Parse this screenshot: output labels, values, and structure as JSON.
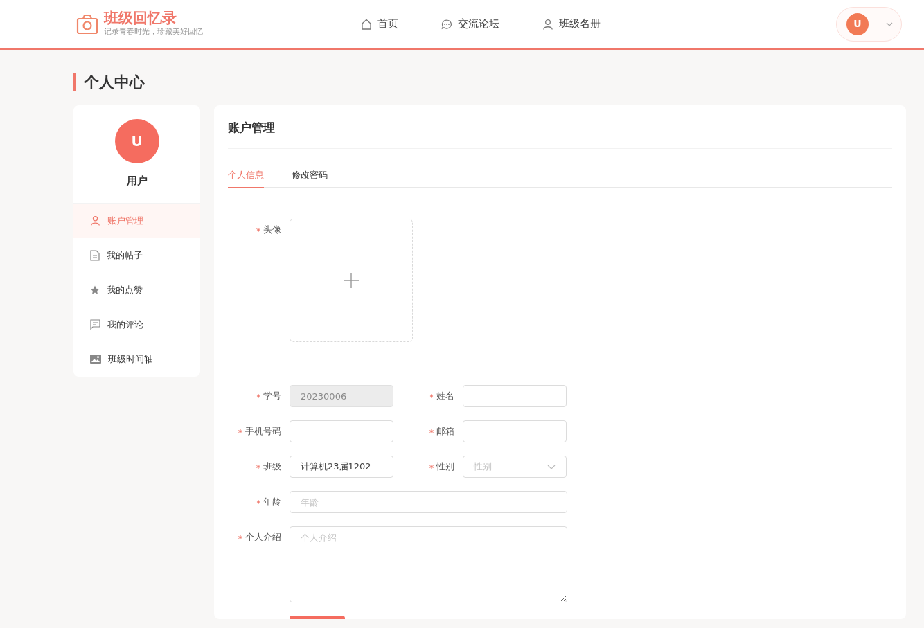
{
  "brand": {
    "title": "班级回忆录",
    "subtitle": "记录青春时光，珍藏美好回忆"
  },
  "nav": [
    {
      "label": "首页",
      "selected": false
    },
    {
      "label": "交流论坛",
      "selected": false
    },
    {
      "label": "班级名册",
      "selected": false
    }
  ],
  "user_menu": {
    "avatar": "U"
  },
  "page_title": "个人中心",
  "profile": {
    "avatar": "U",
    "name": "用户"
  },
  "side_menu": [
    {
      "label": "账户管理",
      "selected": true
    },
    {
      "label": "我的帖子",
      "selected": false
    },
    {
      "label": "我的点赞",
      "selected": false
    },
    {
      "label": "我的评论",
      "selected": false
    },
    {
      "label": "班级时间轴",
      "selected": false
    }
  ],
  "panel": {
    "title": "账户管理",
    "tabs": [
      {
        "label": "个人信息",
        "selected": true
      },
      {
        "label": "修改密码",
        "selected": false
      }
    ],
    "avatar_field": {
      "label": "头像",
      "required": true
    },
    "rows": [
      [
        {
          "label": "学号",
          "required": true,
          "kind": "input",
          "value": "20230006",
          "disabled": true
        },
        {
          "label": "姓名",
          "required": true,
          "kind": "input",
          "disabled": false
        }
      ],
      [
        {
          "label": "手机号码",
          "required": true,
          "kind": "input",
          "disabled": false
        },
        {
          "label": "邮箱",
          "required": true,
          "kind": "input",
          "disabled": false
        }
      ],
      [
        {
          "label": "班级",
          "required": true,
          "kind": "input",
          "value": "计算机23届1202",
          "disabled": false
        },
        {
          "label": "性别",
          "required": true,
          "kind": "select",
          "placeholder": "性别",
          "disabled": false
        }
      ],
      [
        {
          "label": "年龄",
          "required": true,
          "kind": "input",
          "placeholder": "年龄",
          "disabled": false
        }
      ],
      [
        {
          "label": "个人介绍",
          "required": true,
          "kind": "textarea",
          "placeholder": "个人介绍",
          "disabled": false
        }
      ]
    ]
  }
}
